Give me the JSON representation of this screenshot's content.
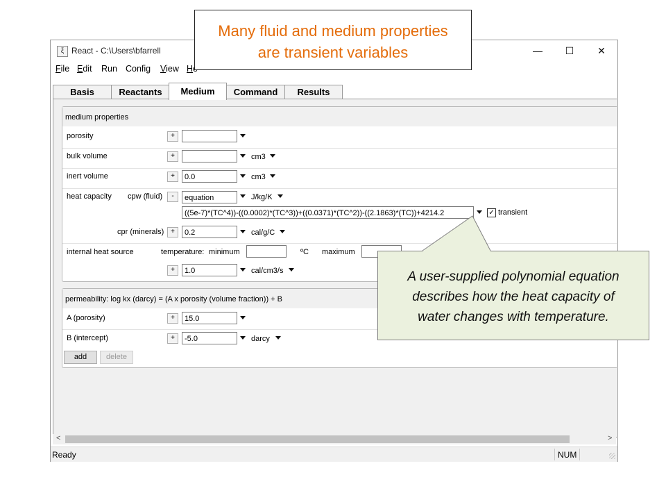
{
  "annotation": {
    "title_line1": "Many fluid and medium properties",
    "title_line2": "are transient variables",
    "callout_line1": "A user-supplied polynomial equation",
    "callout_line2": "describes how the heat capacity of",
    "callout_line3": "water changes with temperature."
  },
  "window": {
    "title": "React - C:\\Users\\bfarrell",
    "icon_glyph": "ξ",
    "minimize": "—",
    "maximize": "☐",
    "close": "✕"
  },
  "menu": {
    "file": {
      "key": "F",
      "rest": "ile"
    },
    "edit": {
      "key": "E",
      "rest": "dit"
    },
    "run": "Run",
    "config": "Config",
    "view": {
      "key": "V",
      "rest": "iew"
    },
    "help": {
      "key": "H",
      "rest": "e"
    }
  },
  "tabs": {
    "basis": "Basis",
    "reactants": "Reactants",
    "medium": "Medium",
    "command": "Command",
    "results": "Results"
  },
  "medium": {
    "header": "medium properties",
    "porosity": {
      "label": "porosity",
      "button": "+",
      "value": ""
    },
    "bulk_volume": {
      "label": "bulk volume",
      "button": "+",
      "value": "",
      "unit": "cm3"
    },
    "inert_volume": {
      "label": "inert volume",
      "button": "+",
      "value": "0.0",
      "unit": "cm3"
    },
    "heat_capacity": {
      "label": "heat capacity",
      "fluid_label": "cpw (fluid)",
      "fluid_button": "-",
      "fluid_value": "equation",
      "fluid_unit": "J/kg/K",
      "equation": "((5e-7)*(TC^4))-((0.0002)*(TC^3))+((0.0371)*(TC^2))-((2.1863)*(TC))+4214.2",
      "transient_label": "transient",
      "transient_checked": "✓",
      "minerals_label": "cpr (minerals)",
      "minerals_button": "+",
      "minerals_value": "0.2",
      "minerals_unit": "cal/g/C"
    },
    "internal_heat": {
      "label": "internal heat source",
      "temp_label": "temperature:",
      "min_label": "minimum",
      "min_value": "",
      "min_unit": "ºC",
      "max_label": "maximum",
      "max_value": "",
      "button": "+",
      "value": "1.0",
      "unit": "cal/cm3/s"
    }
  },
  "permeability": {
    "header": "permeability: log kx (darcy) = (A x porosity (volume fraction)) + B",
    "a_label": "A (porosity)",
    "a_button": "+",
    "a_value": "15.0",
    "b_label": "B (intercept)",
    "b_button": "+",
    "b_value": "-5.0",
    "b_unit": "darcy",
    "add": "add",
    "delete": "delete"
  },
  "scroll": {
    "left": "<",
    "right": ">"
  },
  "status": {
    "text": "Ready",
    "num": "NUM"
  }
}
